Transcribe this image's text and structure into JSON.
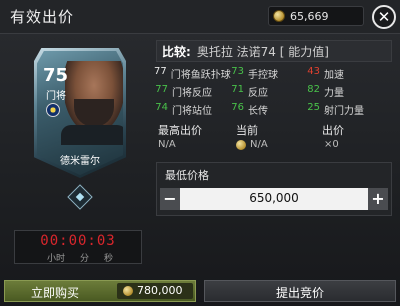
{
  "header": {
    "title": "有效出价",
    "coins": "65,669",
    "close_symbol": "✕"
  },
  "player_card": {
    "rating": "75",
    "position": "门将",
    "name": "德米雷尔"
  },
  "timer": {
    "value": "00:00:03",
    "units": [
      "小时",
      "分",
      "秒"
    ]
  },
  "compare": {
    "label": "比较:",
    "text": "奥托拉 法诺74 [ 能力值]"
  },
  "stats": [
    {
      "value": "77",
      "name": "门将鱼跃扑球",
      "color": "#e8e8e8"
    },
    {
      "value": "73",
      "name": "手控球",
      "color": "#49c24a"
    },
    {
      "value": "43",
      "name": "加速",
      "color": "#e0412f"
    },
    {
      "value": "77",
      "name": "门将反应",
      "color": "#49c24a"
    },
    {
      "value": "71",
      "name": "反应",
      "color": "#49c24a"
    },
    {
      "value": "82",
      "name": "力量",
      "color": "#49c24a"
    },
    {
      "value": "74",
      "name": "门将站位",
      "color": "#49c24a"
    },
    {
      "value": "76",
      "name": "长传",
      "color": "#49c24a"
    },
    {
      "value": "25",
      "name": "射门力量",
      "color": "#49c24a"
    }
  ],
  "info": {
    "highest_bid_label": "最高出价",
    "highest_bid_value": "N/A",
    "current_label": "当前",
    "current_value": "N/A",
    "bids_label": "出价",
    "bids_value": "×0"
  },
  "min_price": {
    "label": "最低价格",
    "value": "650,000",
    "minus": "−",
    "plus": "+"
  },
  "buttons": {
    "buy_now_label": "立即购买",
    "buy_now_price": "780,000",
    "bid_label": "提出竞价"
  }
}
